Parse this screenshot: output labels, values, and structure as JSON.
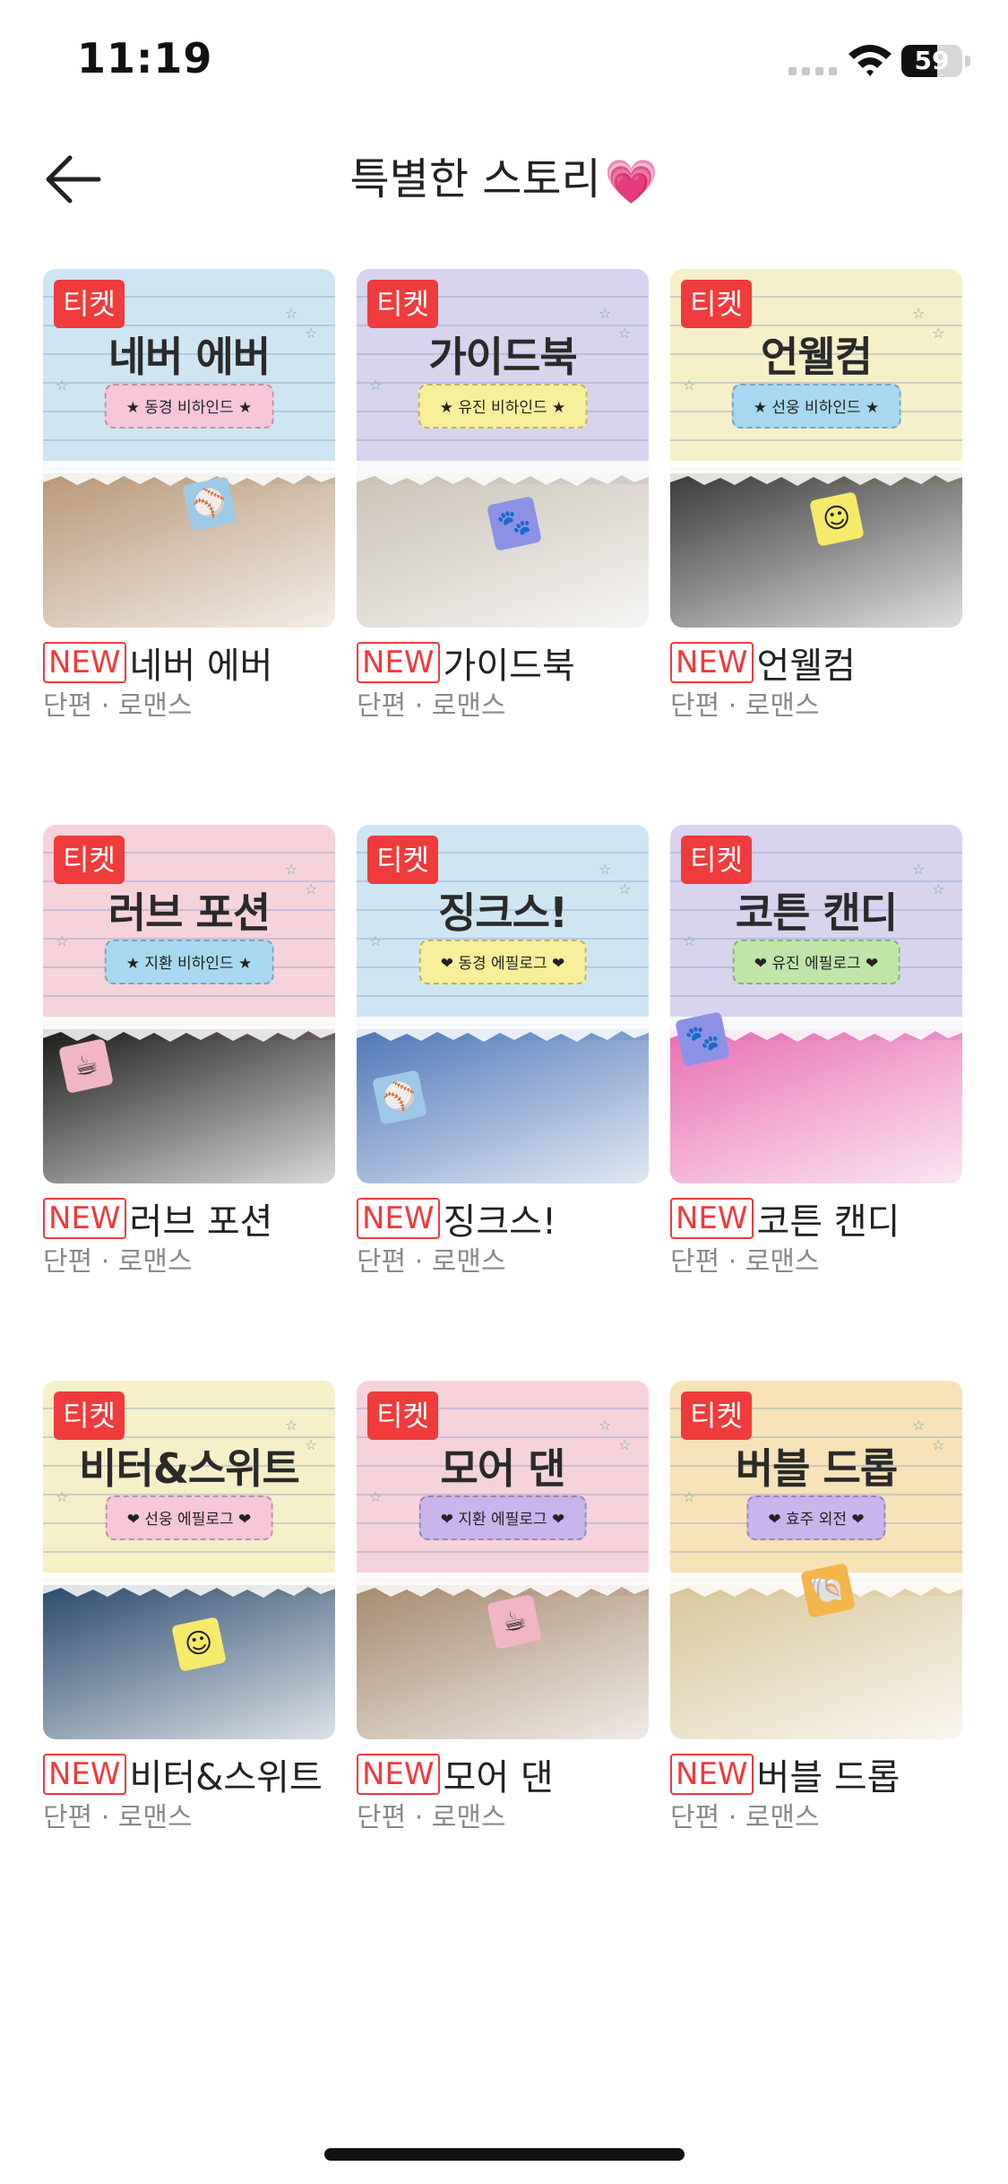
{
  "status_bar": {
    "time": "11:19",
    "battery": "59",
    "battery_level": 0.59
  },
  "header": {
    "title": "특별한 스토리",
    "title_emoji": "💗"
  },
  "cards": [
    {
      "tag": "티켓",
      "cover_title": "네버 에버",
      "ribbon": "★ 동경 비하인드 ★",
      "new_label": "NEW",
      "name": "네버 에버",
      "meta": "단편 · 로맨스",
      "paper": "#cfe6f2",
      "ribbon_color": "#f7c6d9",
      "photo": "#b99877",
      "sticker": "⚾",
      "sticker_color": "#9ec9e6"
    },
    {
      "tag": "티켓",
      "cover_title": "가이드북",
      "ribbon": "★ 유진 비하인드 ★",
      "new_label": "NEW",
      "name": "가이드북",
      "meta": "단편 · 로맨스",
      "paper": "#d8d4ee",
      "ribbon_color": "#f8ef9a",
      "photo": "#c9c2b6",
      "sticker": "🐾",
      "sticker_color": "#8c91e6"
    },
    {
      "tag": "티켓",
      "cover_title": "언웰컴",
      "ribbon": "★ 선웅 비하인드 ★",
      "new_label": "NEW",
      "name": "언웰컴",
      "meta": "단편 · 로맨스",
      "paper": "#f6f0c8",
      "ribbon_color": "#a8d8ef",
      "photo": "#3a3a3a",
      "sticker": "☺",
      "sticker_color": "#f6ea6a"
    },
    {
      "tag": "티켓",
      "cover_title": "러브 포션",
      "ribbon": "★ 지환 비하인드 ★",
      "new_label": "NEW",
      "name": "러브 포션",
      "meta": "단편 · 로맨스",
      "paper": "#f6d3da",
      "ribbon_color": "#a8d8ef",
      "photo": "#1c1b1a",
      "sticker": "☕",
      "sticker_color": "#f0b6c4"
    },
    {
      "tag": "티켓",
      "cover_title": "징크스!",
      "ribbon": "❤ 동경 에필로그 ❤",
      "new_label": "NEW",
      "name": "징크스!",
      "meta": "단편 · 로맨스",
      "paper": "#cfe6f2",
      "ribbon_color": "#f8ef9a",
      "photo": "#4e78b8",
      "sticker": "⚾",
      "sticker_color": "#9ec9e6"
    },
    {
      "tag": "티켓",
      "cover_title": "코튼 캔디",
      "ribbon": "❤ 유진 에필로그 ❤",
      "new_label": "NEW",
      "name": "코튼 캔디",
      "meta": "단편 · 로맨스",
      "paper": "#d8d4ee",
      "ribbon_color": "#bfe6a8",
      "photo": "#e86fb3",
      "sticker": "🐾",
      "sticker_color": "#8c91e6"
    },
    {
      "tag": "티켓",
      "cover_title": "비터&스위트",
      "ribbon": "❤ 선웅 에필로그 ❤",
      "new_label": "NEW",
      "name": "비터&스위트",
      "meta": "단편 · 로맨스",
      "paper": "#f6f0c8",
      "ribbon_color": "#f7c6d9",
      "photo": "#2b4b6e",
      "sticker": "☺",
      "sticker_color": "#f6ea6a"
    },
    {
      "tag": "티켓",
      "cover_title": "모어 댄",
      "ribbon": "❤ 지환 에필로그 ❤",
      "new_label": "NEW",
      "name": "모어 댄",
      "meta": "단편 · 로맨스",
      "paper": "#f6d3da",
      "ribbon_color": "#c9b4ec",
      "photo": "#a68a6e",
      "sticker": "☕",
      "sticker_color": "#f0b6c4"
    },
    {
      "tag": "티켓",
      "cover_title": "버블 드롭",
      "ribbon": "❤ 효주 외전 ❤",
      "new_label": "NEW",
      "name": "버블 드롭",
      "meta": "단편 · 로맨스",
      "paper": "#f8e2b8",
      "ribbon_color": "#c9b4ec",
      "photo": "#d9c79a",
      "sticker": "🐚",
      "sticker_color": "#f2b64a"
    }
  ]
}
